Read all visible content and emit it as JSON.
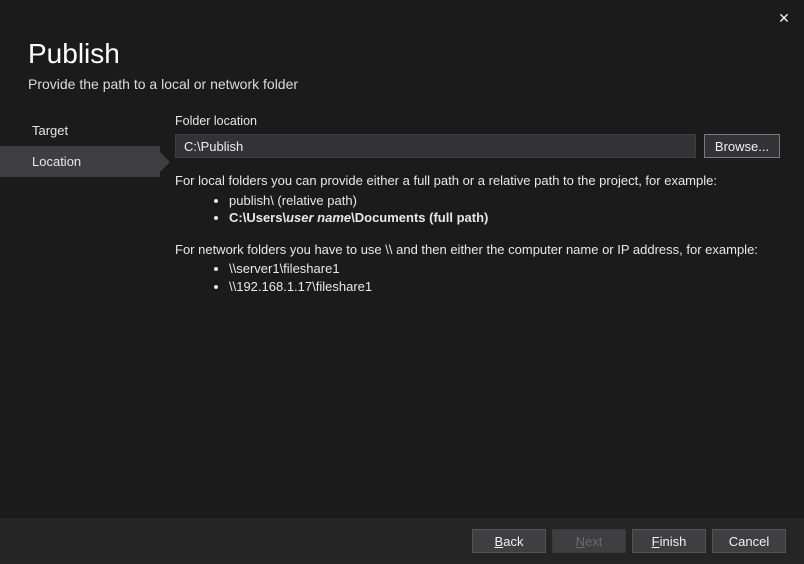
{
  "window": {
    "title": "Publish",
    "subtitle": "Provide the path to a local or network folder"
  },
  "sidebar": {
    "items": [
      {
        "label": "Target",
        "active": false
      },
      {
        "label": "Location",
        "active": true
      }
    ]
  },
  "main": {
    "folder_label": "Folder location",
    "folder_value": "C:\\Publish",
    "browse_label": "Browse...",
    "help_local_intro": "For local folders you can provide either a full path or a relative path to the project, for example:",
    "help_local_1": "publish\\ (relative path)",
    "help_local_2a": "C:\\Users\\",
    "help_local_2b": "user name",
    "help_local_2c": "\\Documents (full path)",
    "help_net_intro": "For network folders you have to use \\\\ and then either the computer name or IP address, for example:",
    "help_net_1": "\\\\server1\\fileshare1",
    "help_net_2": "\\\\192.168.1.17\\fileshare1"
  },
  "footer": {
    "back": "Back",
    "next": "Next",
    "finish": "Finish",
    "cancel": "Cancel"
  }
}
